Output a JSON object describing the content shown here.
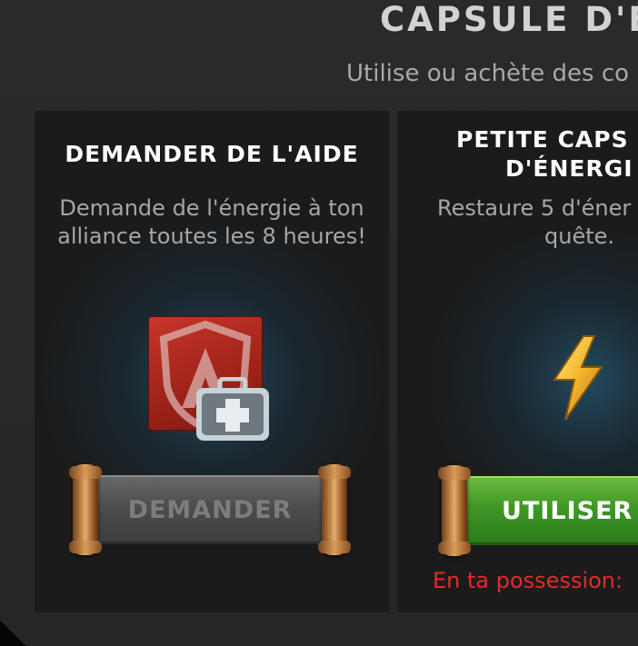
{
  "dialog": {
    "title": "CAPSULE D'É",
    "subtitle": "Utilise ou achète des co"
  },
  "cards": {
    "help": {
      "title": "DEMANDER DE L'AIDE",
      "description_line1": "Demande de l'énergie à ton",
      "description_line2": "alliance toutes les 8 heures!",
      "button_label": "DEMANDER",
      "button_state": "disabled",
      "icon": "alliance-help-icon"
    },
    "energy": {
      "title_line1": "PETITE CAPS",
      "title_line2": "D'ÉNERGI",
      "description_line1": "Restaure 5 d'éner",
      "description_line2": "quête.",
      "button_label": "UTILISER",
      "owned_label": "En ta possession:",
      "icon": "lightning-bolt-icon"
    }
  },
  "colors": {
    "accent_green": "#3f9826",
    "warning_red": "#e32a2a",
    "card_bg": "#1b1b1b"
  }
}
